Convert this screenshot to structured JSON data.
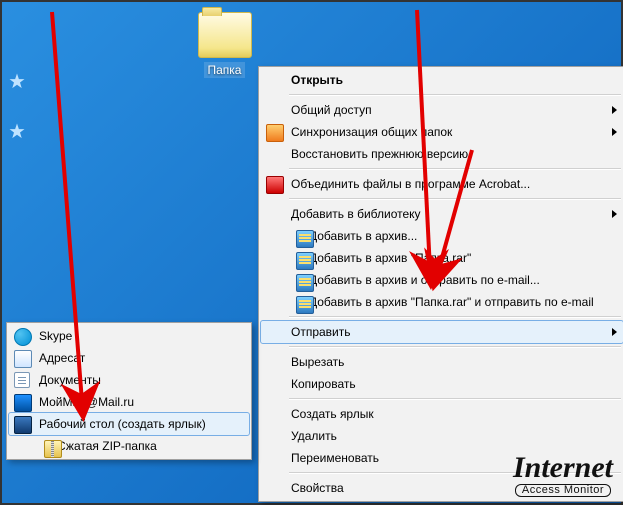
{
  "folder_label": "Папка",
  "main_menu": {
    "open": "Открыть",
    "share": "Общий доступ",
    "sync": "Синхронизация общих папок",
    "restore": "Восстановить прежнюю версию",
    "acrobat": "Объединить файлы в программе Acrobat...",
    "library": "Добавить в библиотеку",
    "rar1": "Добавить в архив...",
    "rar2": "Добавить в архив \"Папка.rar\"",
    "rar3": "Добавить в архив и отправить по e-mail...",
    "rar4": "Добавить в архив \"Папка.rar\" и отправить по e-mail",
    "send": "Отправить",
    "cut": "Вырезать",
    "copy": "Копировать",
    "shortcut": "Создать ярлык",
    "delete": "Удалить",
    "rename": "Переименовать",
    "props": "Свойства"
  },
  "send_menu": {
    "skype": "Skype",
    "addr": "Адресат",
    "docs": "Документы",
    "moimir": "МойМир@Mail.ru",
    "desktop": "Рабочий стол (создать ярлык)",
    "zip": "Сжатая ZIP-папка"
  },
  "watermark": {
    "line1": "Internet",
    "line2": "Access Monitor"
  }
}
